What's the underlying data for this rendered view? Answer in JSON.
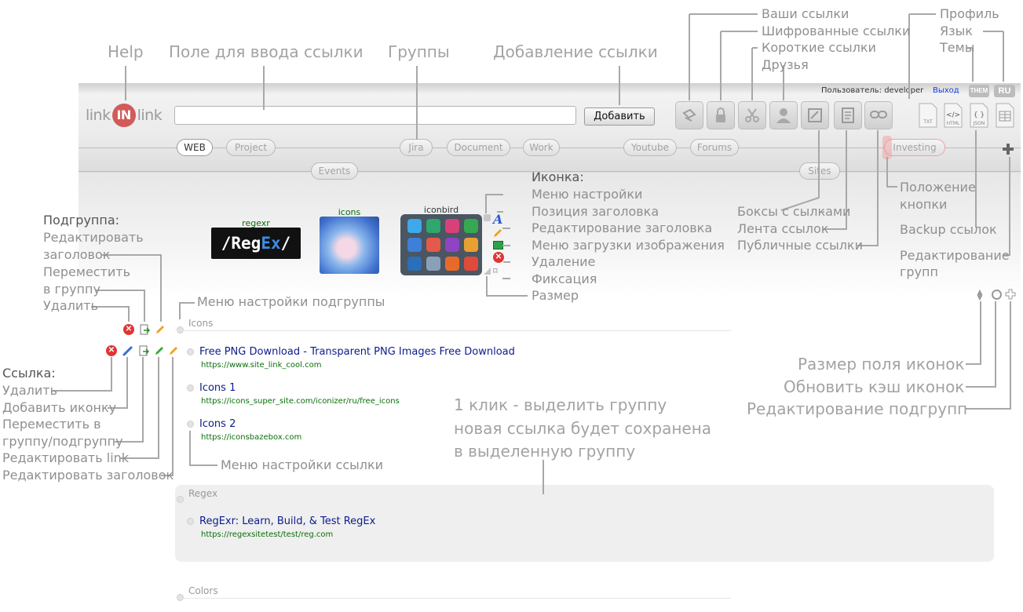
{
  "annotations": {
    "help": "Help",
    "url_field": "Поле для ввода ссылки",
    "groups": "Группы",
    "add_link": "Добавление ссылки",
    "your_links": "Ваши ссылки",
    "encrypted_links": "Шифрованные ссылки",
    "short_links": "Короткие ссылки",
    "friends": "Друзья",
    "profile": "Профиль",
    "language": "Язык",
    "themes": "Темы",
    "icon_heading": "Иконка:",
    "icon_settings_menu": "Меню настройки",
    "title_position": "Позиция заголовка",
    "title_edit": "Редактирование заголовка",
    "image_upload_menu": "Меню загрузки изображения",
    "icon_delete": "Удаление",
    "icon_fix": "Фиксация",
    "icon_size": "Размер",
    "link_boxes": "Боксы с сылками",
    "link_feed": "Лента ссылок",
    "public_links": "Публичные ссылки",
    "button_position": "Положение",
    "button_position_2": "кнопки",
    "backup": "Backup ссылок",
    "edit_groups": "Редактирование",
    "edit_groups_2": "групп",
    "subgroup_heading": "Подгруппа:",
    "sub_edit_title": "Редактировать",
    "sub_edit_title_2": "заголовок",
    "sub_move": "Переместить",
    "sub_move_2": "в группу",
    "sub_delete": "Удалить",
    "subgroup_menu": "Меню настройки подгруппы",
    "link_heading": "Ссылка:",
    "link_delete": "Удалить",
    "link_add_icon": "Добавить иконку",
    "link_move": "Переместить в",
    "link_move_2": "группу/подгруппу",
    "link_edit_link": "Редактировать link",
    "link_edit_title": "Редактировать заголовок",
    "link_menu": "Меню настройки ссылки",
    "icon_field_size": "Размер поля иконок",
    "refresh_cache": "Обновить кэш иконок",
    "edit_subgroups": "Редактирование подгрупп",
    "click_note_1": "1 клик - выделить группу",
    "click_note_2": "новая ссылка будет сохранена",
    "click_note_3": "в выделенную группу"
  },
  "header": {
    "logo_left": "link",
    "logo_in": "IN",
    "logo_right": "link",
    "url_placeholder": "",
    "add_button": "Добавить",
    "user_label": "Пользователь: developer",
    "logout": "Выход",
    "theme_button": "THEM",
    "lang_button": "RU"
  },
  "tabs": {
    "row1": [
      "WEB",
      "Project",
      "Jira",
      "Document",
      "Work",
      "Youtube",
      "Forums",
      "Investing"
    ],
    "row2": [
      "Events",
      "Sites"
    ]
  },
  "icons_row": {
    "regexr_title": "regexr",
    "regexr_logo_a": "/Reg",
    "regexr_logo_b": "Ex",
    "regexr_logo_c": "/",
    "icons_title": "icons",
    "iconbird_title": "iconbird"
  },
  "groups": [
    {
      "title": "Icons",
      "links": [
        {
          "title": "Free PNG Download - Transparent PNG Images Free Download",
          "url": "https://www.site_link_cool.com"
        },
        {
          "title": "Icons 1",
          "url": "https://icons_super_site.com/iconizer/ru/free_icons"
        },
        {
          "title": "Icons 2",
          "url": "https://iconsbazebox.com"
        }
      ]
    },
    {
      "title": "Regex",
      "links": [
        {
          "title": "RegExr: Learn, Build, & Test RegEx",
          "url": "https://regexsitetest/test/reg.com"
        }
      ]
    },
    {
      "title": "Colors",
      "links": []
    }
  ],
  "colors": {
    "accent": "#d25a5a",
    "link_title": "#0c1c8c",
    "link_url": "#0a6f0a",
    "annotation": "#8f8f8f"
  }
}
